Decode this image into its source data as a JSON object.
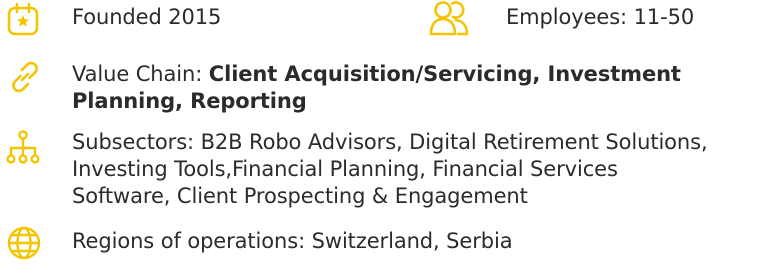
{
  "accent_color": "#f5c400",
  "founded": {
    "icon": "calendar-star-icon",
    "text": "Founded 2015"
  },
  "employees": {
    "icon": "people-icon",
    "text": "Employees: 11-50"
  },
  "value_chain": {
    "icon": "link-icon",
    "label": "Value Chain: ",
    "value_line1": "Client Acquisition/Servicing, Investment",
    "value_line2": "Planning, Reporting"
  },
  "subsectors": {
    "icon": "hierarchy-icon",
    "line1": "Subsectors: B2B Robo Advisors, Digital Retirement Solutions,",
    "line2": "Investing Tools,Financial Planning, Financial Services",
    "line3": "Software, Client Prospecting & Engagement"
  },
  "regions": {
    "icon": "globe-icon",
    "text": "Regions of operations: Switzerland, Serbia"
  }
}
